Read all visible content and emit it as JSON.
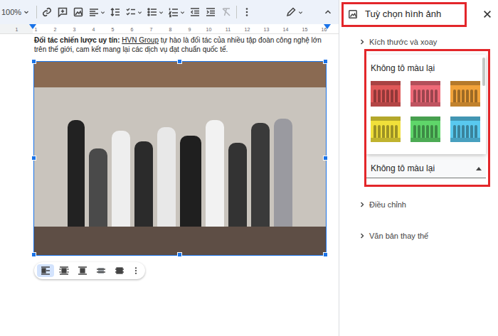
{
  "toolbar": {
    "zoom": "100%"
  },
  "ruler": {
    "labels": [
      "1",
      "1",
      "2",
      "3",
      "4",
      "5",
      "6",
      "7",
      "8",
      "9",
      "10",
      "11",
      "12",
      "13",
      "14",
      "15",
      "16"
    ]
  },
  "document": {
    "paragraph": {
      "lead": "Đối tác chiến lược uy tín: ",
      "link": "HVN Group",
      "body": " tự hào là đối tác của nhiều tập đoàn công nghệ lớn trên thế giới, cam kết mang lại các dịch vụ đạt chuẩn quốc tế."
    },
    "image": {
      "selected": true
    },
    "wrap_options": [
      {
        "kind": "inline",
        "selected": true
      },
      {
        "kind": "wrap",
        "selected": false
      },
      {
        "kind": "break",
        "selected": false
      },
      {
        "kind": "behind",
        "selected": false
      },
      {
        "kind": "front",
        "selected": false
      }
    ]
  },
  "panel": {
    "title": "Tuỳ chọn hình ảnh",
    "sections_before": [
      {
        "label": "Kích thước và xoay",
        "expanded": false
      }
    ],
    "recolor": {
      "expanded": true,
      "menu_title": "Không tô màu lại",
      "swatches": [
        {
          "color": "#e05858"
        },
        {
          "color": "#ef6a78"
        },
        {
          "color": "#f2a33a"
        },
        {
          "color": "#f1e03a"
        },
        {
          "color": "#5fd66a"
        },
        {
          "color": "#59c9ef"
        }
      ],
      "value": "Không tô màu lại"
    },
    "sections_after": [
      {
        "label": "Điều chỉnh",
        "expanded": false
      },
      {
        "label": "Văn bản thay thế",
        "expanded": false
      }
    ]
  }
}
